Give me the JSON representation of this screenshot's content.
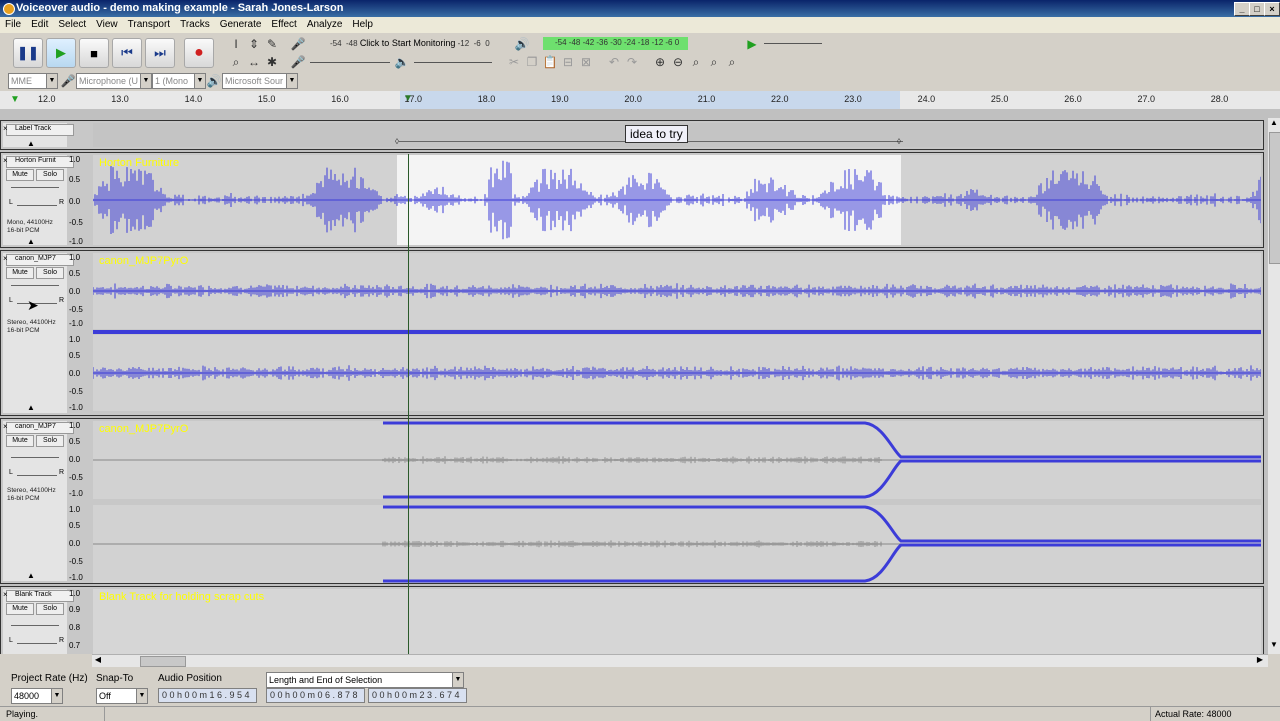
{
  "window": {
    "title": "Voiceover audio - demo making example - Sarah Jones-Larson"
  },
  "menu": [
    "File",
    "Edit",
    "Select",
    "View",
    "Transport",
    "Tracks",
    "Generate",
    "Effect",
    "Analyze",
    "Help"
  ],
  "meters": {
    "record_scale": [
      "-54",
      "-48"
    ],
    "record_prompt": "Click to Start Monitoring",
    "record_scale_right": [
      "-12",
      "-6",
      "0"
    ],
    "play_scale": [
      "-54",
      "-48",
      "-42",
      "-36",
      "-30",
      "-24",
      "-18",
      "-12",
      "-6",
      "0"
    ]
  },
  "device": {
    "host": "MME",
    "input": "Microphone (U",
    "channels": "1 (Mono",
    "output": "Microsoft Sour"
  },
  "ruler": {
    "ticks": [
      "12.0",
      "13.0",
      "14.0",
      "15.0",
      "16.0",
      "17.0",
      "18.0",
      "19.0",
      "20.0",
      "21.0",
      "22.0",
      "23.0",
      "24.0",
      "25.0",
      "26.0",
      "27.0",
      "28.0"
    ]
  },
  "label_track": {
    "name": "Label Track",
    "label": "idea to try"
  },
  "tracks": [
    {
      "name": "Horton Furnit",
      "clip_name": "Horton Furniture",
      "info": [
        "Mono, 44100Hz",
        "16-bit PCM"
      ]
    },
    {
      "name": "canon_MJP7",
      "clip_name": "canon_MJP7PyrO",
      "info": [
        "Stereo, 44100Hz",
        "16-bit PCM"
      ]
    },
    {
      "name": "canon_MJP7",
      "clip_name": "canon_MJP7PyrO",
      "info": [
        "Stereo, 44100Hz",
        "16-bit PCM"
      ]
    },
    {
      "name": "Blank Track",
      "clip_name": "Blank Track for holding scrap cuts",
      "info": []
    }
  ],
  "track_buttons": {
    "mute": "Mute",
    "solo": "Solo",
    "pan_left": "L",
    "pan_right": "R"
  },
  "vscale": {
    "top": "1.0",
    "half": "0.5",
    "zero": "0.0",
    "nhalf": "-0.5",
    "bottom": "-1.0",
    "blank_mid": "0.9",
    "blank_low": "0.8",
    "blank_lower": "0.7"
  },
  "selection_bar": {
    "project_rate_label": "Project Rate (Hz)",
    "project_rate": "48000",
    "snap_label": "Snap-To",
    "snap_value": "Off",
    "audio_position_label": "Audio Position",
    "audio_position": "0 0 h 0 0 m 1 6 . 9 5 4 s",
    "selection_mode": "Length and End of Selection",
    "sel_length": "0 0 h 0 0 m 0 6 . 8 7 8 s",
    "sel_end": "0 0 h 0 0 m 2 3 . 6 7 4 s"
  },
  "status": {
    "left": "Playing.",
    "right": "Actual Rate: 48000"
  },
  "colors": {
    "wave": "#3c3cd8",
    "wave_gray": "#888888",
    "track_name": "#ffff00",
    "meter_green": "#6ee06e"
  }
}
